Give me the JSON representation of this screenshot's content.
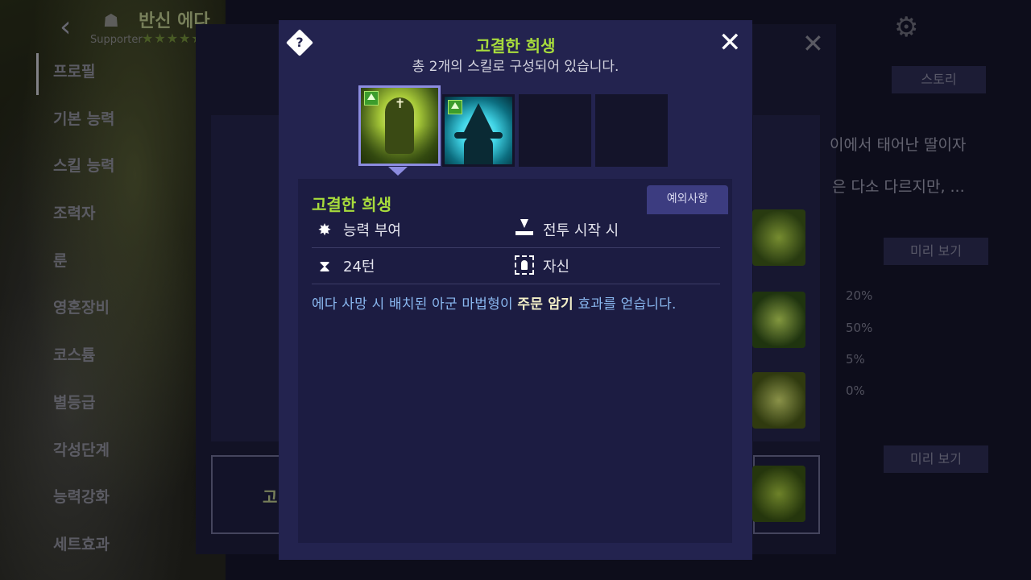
{
  "header": {
    "back_icon": "chevron-left-icon",
    "character_name": "반신 에다",
    "role_label": "Supporter",
    "stars": "★★★★★"
  },
  "side_menu": {
    "items": [
      {
        "label": "프로필"
      },
      {
        "label": "기본 능력"
      },
      {
        "label": "스킬 능력"
      },
      {
        "label": "조력자"
      },
      {
        "label": "룬"
      },
      {
        "label": "영혼장비"
      },
      {
        "label": "코스튬"
      },
      {
        "label": "별등급"
      },
      {
        "label": "각성단계"
      },
      {
        "label": "능력강화"
      },
      {
        "label": "세트효과"
      }
    ]
  },
  "background_panel": {
    "story_button": "스토리",
    "story_line_1": "이에서 태어난 딸이자",
    "story_line_2": "은 다소 다르지만, ...",
    "preview_button_1": "미리 보기",
    "preview_button_2": "미리 보기",
    "percents": [
      "20%",
      "50%",
      "5%",
      "0%"
    ],
    "left_box_text": "고"
  },
  "popup": {
    "title": "고결한 희생",
    "subtitle": "총 2개의 스킬로 구성되어 있습니다.",
    "close_icon": "close-icon",
    "help_icon": "help-icon",
    "skills": [
      {
        "name": "holy-sacrifice-skill",
        "selected": true,
        "upgrade": true
      },
      {
        "name": "witch-skill",
        "selected": false,
        "upgrade": true
      },
      {
        "name": "empty-slot",
        "selected": false,
        "upgrade": false
      },
      {
        "name": "empty-slot",
        "selected": false,
        "upgrade": false
      }
    ],
    "detail": {
      "name": "고결한 희생",
      "exception_button": "예외사항",
      "attributes": {
        "type": "능력 부여",
        "timing": "전투 시작 시",
        "duration": "24턴",
        "target": "자신"
      },
      "description": {
        "part1": "에다 사망 시 배치된 아군 마법형이 ",
        "highlight": "주문 암기",
        "part2": " 효과를 얻습니다."
      }
    }
  },
  "colors": {
    "accent_green": "#a8dc3c",
    "popup_bg": "#23234f",
    "description_blue": "#8ab8f0"
  }
}
